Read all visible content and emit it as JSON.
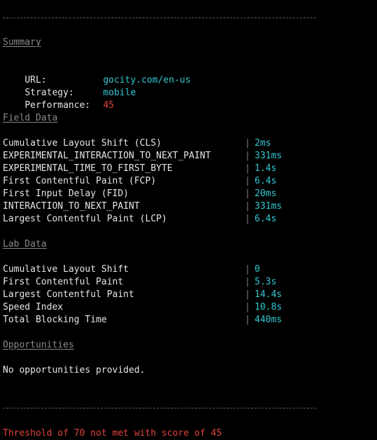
{
  "summary": {
    "heading": "Summary",
    "url_label": "URL:",
    "url_value": "gocity.com/en-us",
    "strategy_label": "Strategy:",
    "strategy_value": "mobile",
    "performance_label": "Performance:",
    "performance_value": "45"
  },
  "field_data": {
    "heading": "Field Data",
    "separator": "|",
    "rows": [
      {
        "metric": "Cumulative Layout Shift (CLS)",
        "value": "2ms"
      },
      {
        "metric": "EXPERIMENTAL_INTERACTION_TO_NEXT_PAINT",
        "value": "331ms"
      },
      {
        "metric": "EXPERIMENTAL_TIME_TO_FIRST_BYTE",
        "value": "1.4s"
      },
      {
        "metric": "First Contentful Paint (FCP)",
        "value": "6.4s"
      },
      {
        "metric": "First Input Delay (FID)",
        "value": "20ms"
      },
      {
        "metric": "INTERACTION_TO_NEXT_PAINT",
        "value": "331ms"
      },
      {
        "metric": "Largest Contentful Paint (LCP)",
        "value": "6.4s"
      }
    ]
  },
  "lab_data": {
    "heading": "Lab Data",
    "separator": "|",
    "rows": [
      {
        "metric": "Cumulative Layout Shift",
        "value": "0"
      },
      {
        "metric": "First Contentful Paint",
        "value": "5.3s"
      },
      {
        "metric": "Largest Contentful Paint",
        "value": "14.4s"
      },
      {
        "metric": "Speed Index",
        "value": "10.8s"
      },
      {
        "metric": "Total Blocking Time",
        "value": "440ms"
      }
    ]
  },
  "opportunities": {
    "heading": "Opportunities",
    "message": "No opportunities provided."
  },
  "result": {
    "message": "Threshold of 70 not met with score of 45"
  },
  "colors": {
    "background": "#000000",
    "text": "#e6e6e6",
    "heading": "#8a8a8a",
    "value": "#32c8d2",
    "fail": "#e0433a"
  }
}
